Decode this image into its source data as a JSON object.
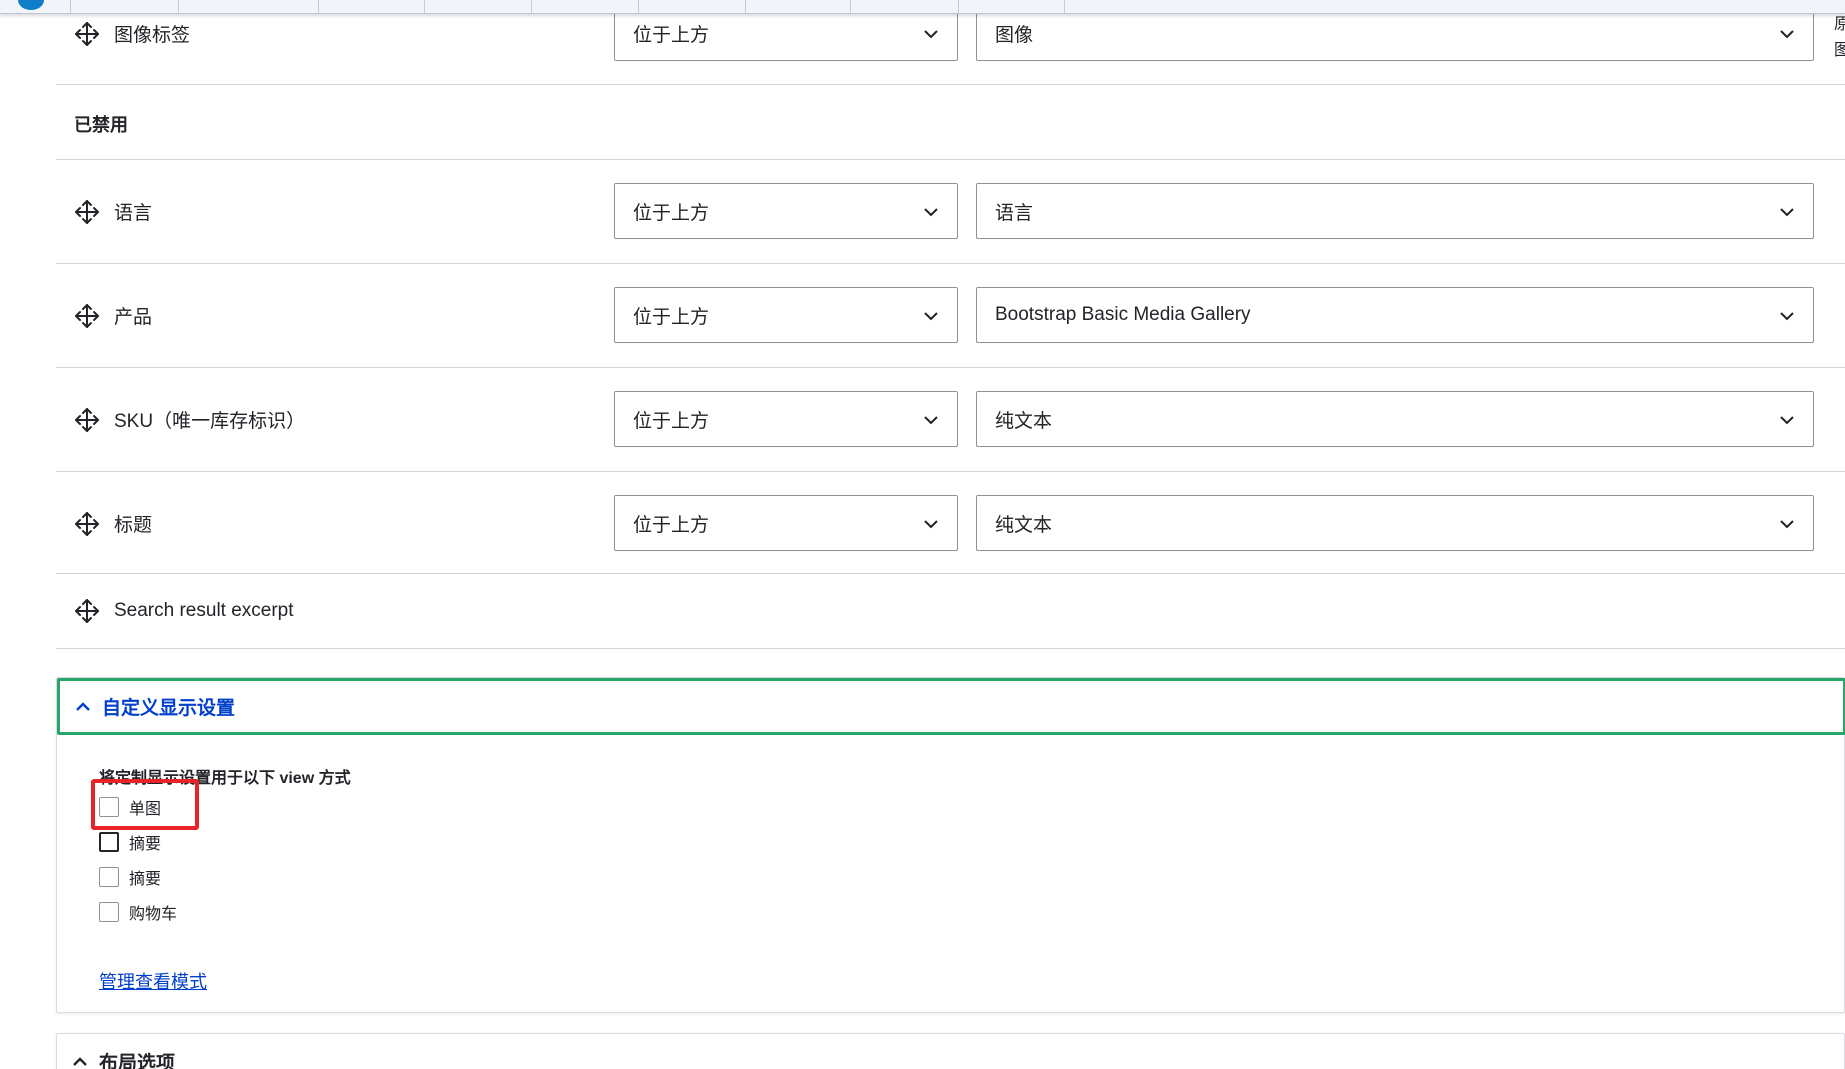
{
  "browser": {
    "tab_count": 10
  },
  "right_overflow_text": "原\n图",
  "rows_enabled": [
    {
      "label": "图像标签",
      "position": "位于上方",
      "format": "图像"
    }
  ],
  "disabled_heading": "已禁用",
  "rows_disabled": [
    {
      "label": "语言",
      "position": "位于上方",
      "format": "语言"
    },
    {
      "label": "产品",
      "position": "位于上方",
      "format": "Bootstrap Basic Media Gallery"
    },
    {
      "label": "SKU（唯一库存标识）",
      "position": "位于上方",
      "format": "纯文本"
    },
    {
      "label": "标题",
      "position": "位于上方",
      "format": "纯文本"
    }
  ],
  "row_plain": {
    "label": "Search result excerpt"
  },
  "custom_display": {
    "summary": "自定义显示设置",
    "fieldset_title": "将定制显示设置用于以下 view 方式",
    "options": [
      {
        "label": "单图",
        "checked": false
      },
      {
        "label": "摘要",
        "checked": false
      },
      {
        "label": "摘要",
        "checked": false
      },
      {
        "label": "购物车",
        "checked": false
      }
    ],
    "manage_link": "管理查看模式"
  },
  "layout_options": {
    "summary": "布局选项"
  },
  "colors": {
    "accent_green": "#26a769",
    "link_blue": "#003ecc",
    "highlight_red": "#e8232a"
  }
}
